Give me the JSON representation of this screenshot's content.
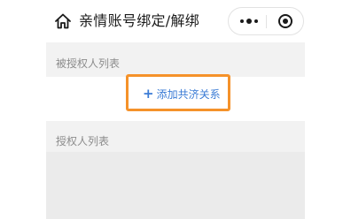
{
  "navbar": {
    "title": "亲情账号绑定/解绑",
    "home_icon": "home-icon",
    "more_icon": "more-dots-icon",
    "close_icon": "miniprogram-close-icon"
  },
  "sections": {
    "authorized_by": {
      "label": "被授权人列表",
      "add_button_label": "添加共济关系",
      "add_icon": "+"
    },
    "authorized": {
      "label": "授权人列表"
    }
  },
  "colors": {
    "accent": "#3a7bd5",
    "highlight": "#f5922a",
    "background": "#f2f2f2",
    "label": "#8c8c8c"
  }
}
